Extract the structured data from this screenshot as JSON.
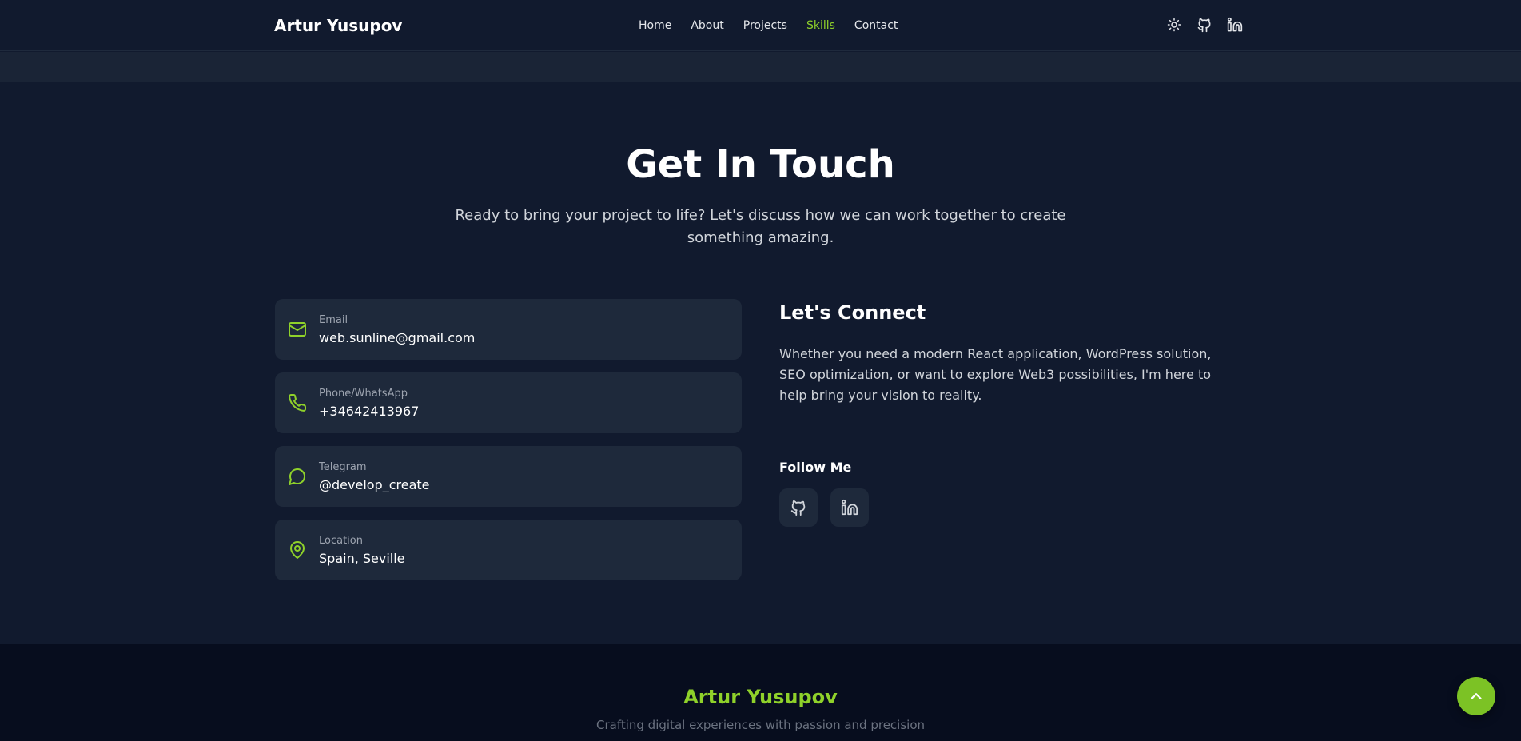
{
  "nav": {
    "brand": "Artur Yusupov",
    "links": [
      {
        "label": "Home",
        "active": false
      },
      {
        "label": "About",
        "active": false
      },
      {
        "label": "Projects",
        "active": false
      },
      {
        "label": "Skills",
        "active": true
      },
      {
        "label": "Contact",
        "active": false
      }
    ],
    "icons": [
      "sun-icon",
      "github-icon",
      "linkedin-icon"
    ]
  },
  "hero": {
    "title": "Get In Touch",
    "subtitle": "Ready to bring your project to life? Let's discuss how we can work together to create something amazing."
  },
  "contacts": [
    {
      "icon": "mail-icon",
      "label": "Email",
      "value": "web.sunline@gmail.com"
    },
    {
      "icon": "phone-icon",
      "label": "Phone/WhatsApp",
      "value": "+34642413967"
    },
    {
      "icon": "chat-icon",
      "label": "Telegram",
      "value": "@develop_create"
    },
    {
      "icon": "map-pin-icon",
      "label": "Location",
      "value": "Spain, Seville"
    }
  ],
  "connect": {
    "title": "Let's Connect",
    "text": "Whether you need a modern React application, WordPress solution, SEO optimization, or want to explore Web3 possibilities, I'm here to help bring your vision to reality.",
    "follow_title": "Follow Me",
    "socials": [
      "github-icon",
      "linkedin-icon"
    ]
  },
  "footer": {
    "brand": "Artur Yusupov",
    "tagline": "Crafting digital experiences with passion and precision"
  },
  "colors": {
    "accent": "#8fd12a",
    "background": "#111a2e",
    "card": "#1e293b",
    "footer": "#070d1e"
  }
}
